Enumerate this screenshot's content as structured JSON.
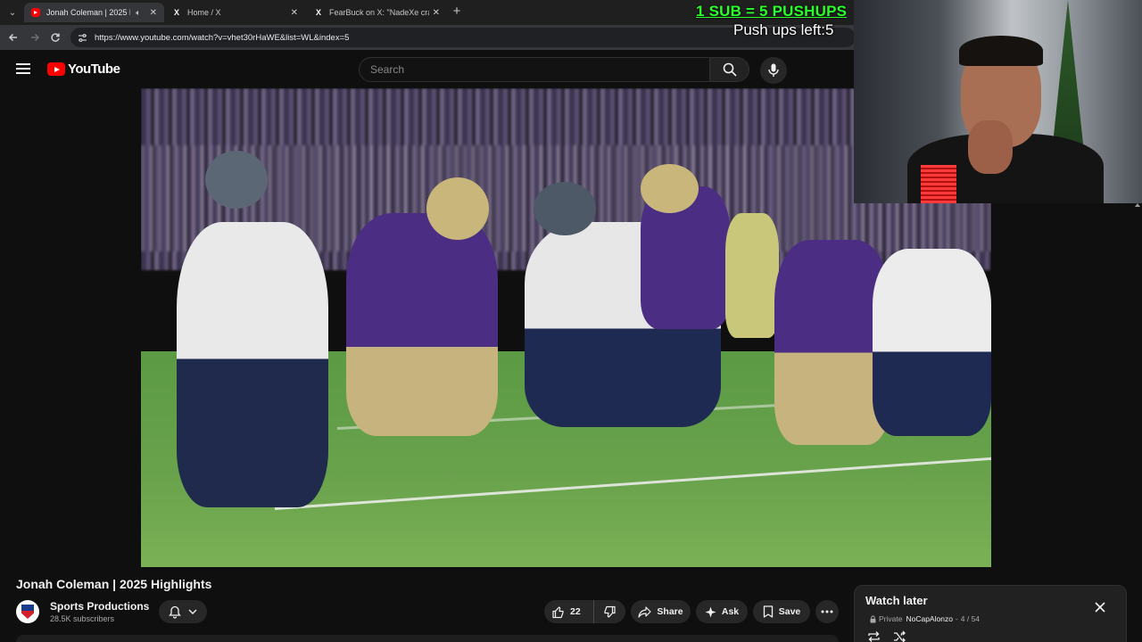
{
  "browser": {
    "tabs": [
      {
        "title": "Jonah Coleman | 2025 Highlights",
        "favicon": "youtube-icon",
        "active": true,
        "audio": true
      },
      {
        "title": "Home / X",
        "favicon": "x-icon",
        "active": false
      },
      {
        "title": "FearBuck on X: \"NadeXe crashe",
        "favicon": "x-icon",
        "active": false
      }
    ],
    "url": "https://www.youtube.com/watch?v=vhet30rHaWE&list=WL&index=5"
  },
  "youtube": {
    "logo_text": "YouTube",
    "search_placeholder": "Search"
  },
  "overlay": {
    "sub_banner": "1 SUB = 5 PUSHUPS",
    "pushups_left": "Push ups left:5"
  },
  "video": {
    "title": "Jonah Coleman | 2025 Highlights",
    "channel_name": "Sports Productions",
    "subscribers": "28.5K subscribers",
    "like_count": "22",
    "share_label": "Share",
    "ask_label": "Ask",
    "save_label": "Save"
  },
  "playlist": {
    "title": "Watch later",
    "privacy": "Private",
    "owner": "NoCapAlonzo",
    "position": "4 / 54"
  },
  "colors": {
    "youtube_red": "#ff0000",
    "banner_green": "#2bff2b",
    "background": "#0f0f0f"
  }
}
